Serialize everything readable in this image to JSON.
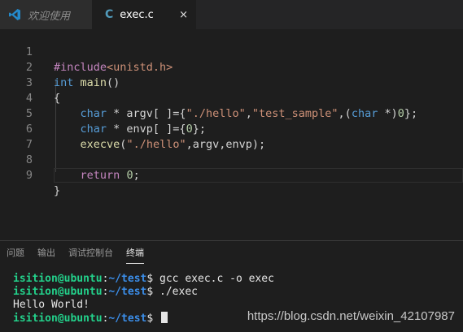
{
  "tabs": [
    {
      "label": "欢迎使用",
      "active": false,
      "icon": "vscode-icon"
    },
    {
      "label": "exec.c",
      "active": true,
      "icon": "c-file-icon",
      "icon_glyph": "C",
      "close": "×"
    }
  ],
  "editor": {
    "line_numbers": [
      "1",
      "2",
      "3",
      "4",
      "5",
      "6",
      "7",
      "8",
      "9"
    ],
    "code": {
      "l1_pre": "#include",
      "l1_inc": "<unistd.h>",
      "l2_kw": "int",
      "l2_fn": "main",
      "l2_rest": "()",
      "l3": "{",
      "l4_kw": "char",
      "l4_a": " * argv[ ]={",
      "l4_s1": "\"./hello\"",
      "l4_c1": ",",
      "l4_s2": "\"test_sample\"",
      "l4_c2": ",(",
      "l4_kw2": "char",
      "l4_b": " *)",
      "l4_n": "0",
      "l4_end": "};",
      "l5_kw": "char",
      "l5_a": " * envp[ ]={",
      "l5_n": "0",
      "l5_end": "};",
      "l6_fn": "execve",
      "l6_a": "(",
      "l6_s": "\"./hello\"",
      "l6_b": ",argv,envp);",
      "l8_kw": "return",
      "l8_n": "0",
      "l8_end": ";",
      "l9": "}"
    }
  },
  "panel": {
    "tabs": [
      "问题",
      "输出",
      "调试控制台",
      "终端"
    ],
    "active_tab": "终端",
    "terminal": [
      {
        "user": "isition@ubuntu",
        "sep": ":",
        "path": "~/test",
        "prompt": "$ ",
        "cmd": "gcc exec.c -o exec"
      },
      {
        "user": "isition@ubuntu",
        "sep": ":",
        "path": "~/test",
        "prompt": "$ ",
        "cmd": "./exec"
      },
      {
        "output": "Hello World!"
      },
      {
        "user": "isition@ubuntu",
        "sep": ":",
        "path": "~/test",
        "prompt": "$ ",
        "cmd": ""
      }
    ]
  },
  "watermark": "https://blog.csdn.net/weixin_42107987",
  "colors": {
    "accent": "#007acc",
    "keyword": "#569cd6",
    "string": "#ce9178",
    "terminal_user": "#23d18b",
    "terminal_path": "#3b8eea"
  }
}
